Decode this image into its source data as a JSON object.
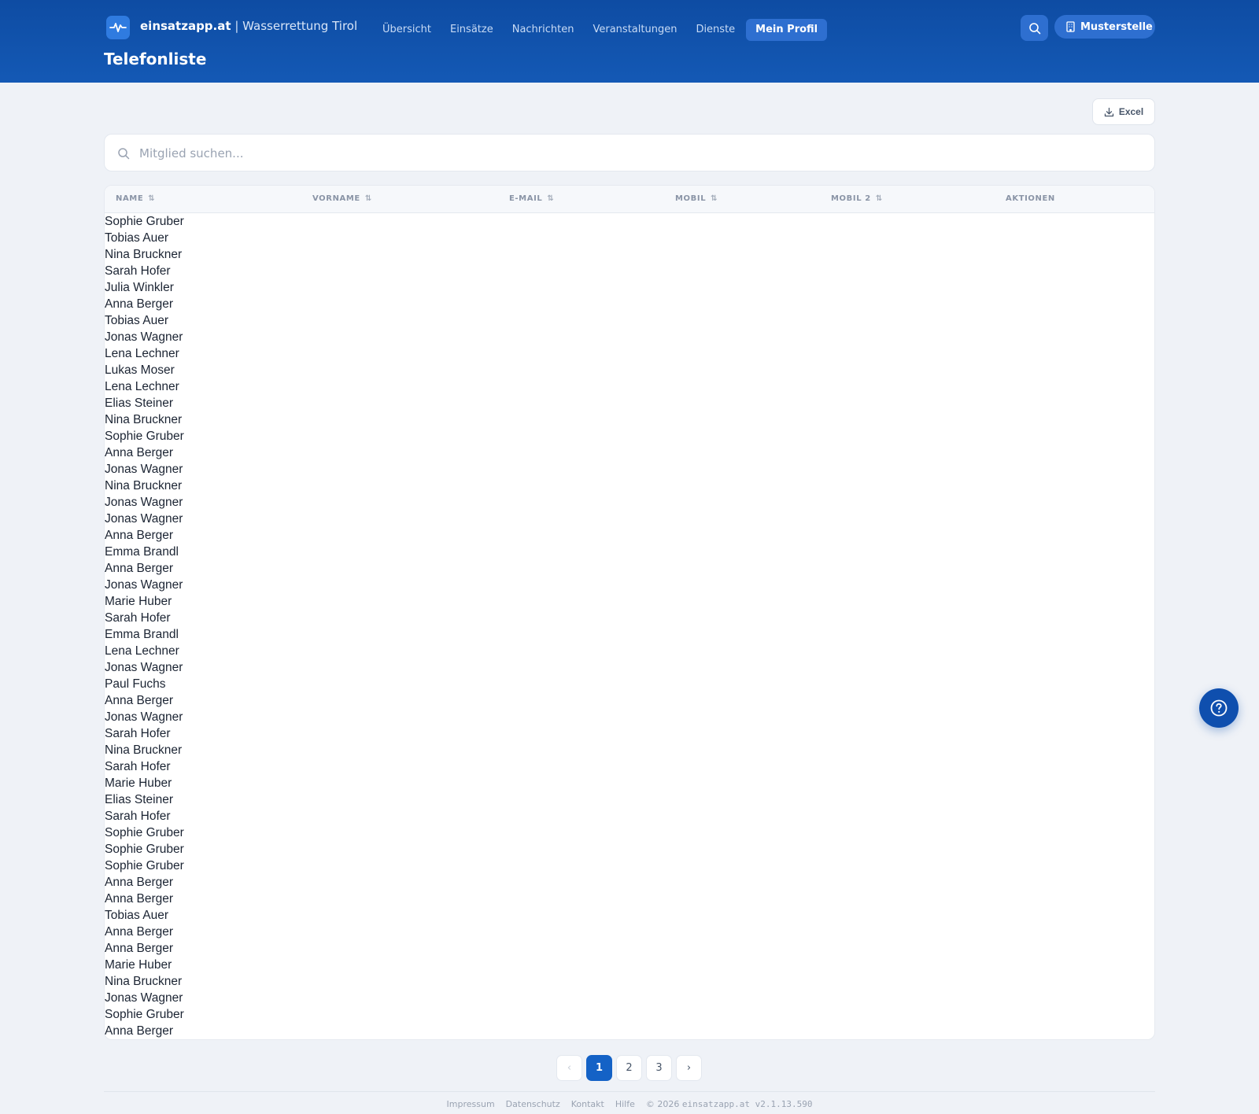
{
  "header": {
    "brand_name": "einsatzapp.at",
    "brand_sep": " | ",
    "org_name": "Wasserrettung Tirol",
    "page_title": "Telefonliste",
    "nav": [
      {
        "label": "Übersicht"
      },
      {
        "label": "Einsätze"
      },
      {
        "label": "Nachrichten"
      },
      {
        "label": "Veranstaltungen"
      },
      {
        "label": "Dienste"
      },
      {
        "label": "Mein Profil",
        "active": true
      }
    ],
    "org_button_label": "Musterstelle"
  },
  "toolbar": {
    "excel_label": "Excel"
  },
  "search": {
    "placeholder": "Mitglied suchen...",
    "value": ""
  },
  "table": {
    "columns": [
      {
        "label": "NAME",
        "sortable": true
      },
      {
        "label": "VORNAME",
        "sortable": true
      },
      {
        "label": "E-MAIL",
        "sortable": true
      },
      {
        "label": "MOBIL",
        "sortable": true
      },
      {
        "label": "MOBIL 2",
        "sortable": true
      },
      {
        "label": "AKTIONEN",
        "sortable": false
      }
    ],
    "sort_icon": "⇅",
    "rows": [
      "Sophie Gruber",
      "Tobias Auer",
      "Nina Bruckner",
      "Sarah Hofer",
      "Julia Winkler",
      "Anna Berger",
      "Tobias Auer",
      "Jonas Wagner",
      "Lena Lechner",
      "Lukas Moser",
      "Lena Lechner",
      "Elias Steiner",
      "Nina Bruckner",
      "Sophie Gruber",
      "Anna Berger",
      "Jonas Wagner",
      "Nina Bruckner",
      "Jonas Wagner",
      "Jonas Wagner",
      "Anna Berger",
      "Emma Brandl",
      "Anna Berger",
      "Jonas Wagner",
      "Marie Huber",
      "Sarah Hofer",
      "Emma Brandl",
      "Lena Lechner",
      "Jonas Wagner",
      "Paul Fuchs",
      "Anna Berger",
      "Jonas Wagner",
      "Sarah Hofer",
      "Nina Bruckner",
      "Sarah Hofer",
      "Marie Huber",
      "Elias Steiner",
      "Sarah Hofer",
      "Sophie Gruber",
      "Sophie Gruber",
      "Sophie Gruber",
      "Anna Berger",
      "Anna Berger",
      "Tobias Auer",
      "Anna Berger",
      "Anna Berger",
      "Marie Huber",
      "Nina Bruckner",
      "Jonas Wagner",
      "Sophie Gruber",
      "Anna Berger"
    ]
  },
  "pagination": {
    "prev": "‹",
    "next": "›",
    "pages": [
      "1",
      "2",
      "3"
    ],
    "current": "1"
  },
  "footer": {
    "links": [
      "Impressum",
      "Datenschutz",
      "Kontakt",
      "Hilfe"
    ],
    "copyright": "© 2026",
    "version": "einsatzapp.at v2.1.13.590"
  },
  "icons": {
    "logo": "pulse-icon",
    "search": "search-icon",
    "org": "building-icon",
    "excel": "download-icon",
    "help": "help-circle-icon"
  },
  "colors": {
    "header_bg": "#0e4ca3",
    "accent": "#1462c6",
    "page_bg": "#eff2f7"
  }
}
